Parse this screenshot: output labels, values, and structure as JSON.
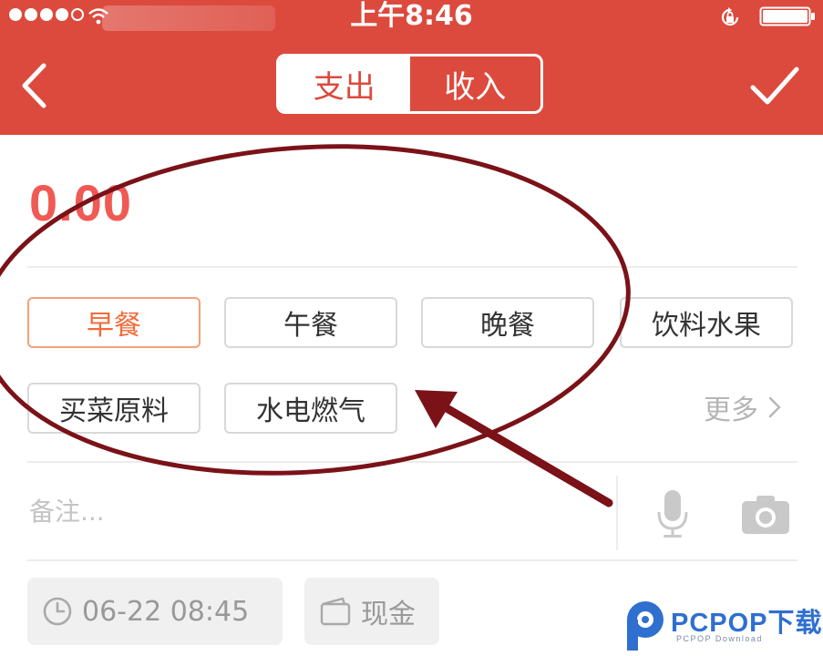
{
  "status_bar": {
    "time": "上午8:46",
    "icons": [
      "signal-dots",
      "wifi-icon",
      "rotation-lock-icon",
      "battery-icon"
    ]
  },
  "header": {
    "background_color": "#dc4a3e",
    "tabs": [
      {
        "label": "支出",
        "active": true
      },
      {
        "label": "收入",
        "active": false
      }
    ],
    "back_icon": "chevron-left-icon",
    "confirm_icon": "checkmark-icon"
  },
  "amount": {
    "value": "0.00",
    "color": "#f05a54"
  },
  "categories": {
    "items": [
      {
        "label": "早餐",
        "selected": true
      },
      {
        "label": "午餐",
        "selected": false
      },
      {
        "label": "晚餐",
        "selected": false
      },
      {
        "label": "饮料水果",
        "selected": false
      },
      {
        "label": "买菜原料",
        "selected": false
      },
      {
        "label": "水电燃气",
        "selected": false
      }
    ],
    "more_label": "更多",
    "selected_color": "#f26b3a"
  },
  "note": {
    "placeholder": "备注..."
  },
  "footer": {
    "datetime": "06-22 08:45",
    "account": "现金"
  },
  "watermark": {
    "title": "PCPOP下载",
    "subtitle": "PCPOP Download"
  },
  "annotation_color": "#7a1218"
}
